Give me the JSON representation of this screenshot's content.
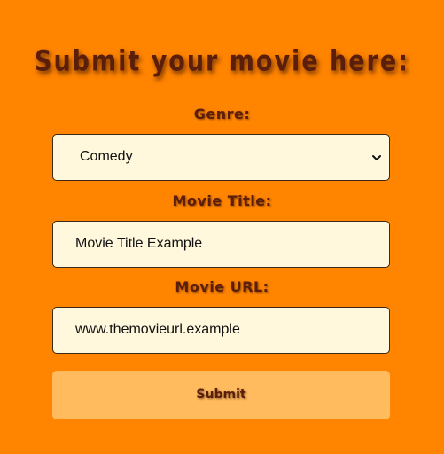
{
  "form": {
    "title": "Submit your movie here:",
    "genre": {
      "label": "Genre:",
      "selected": "Comedy"
    },
    "movie_title": {
      "label": "Movie Title:",
      "value": "Movie Title Example"
    },
    "movie_url": {
      "label": "Movie URL:",
      "value": "www.themovieurl.example"
    },
    "submit_label": "Submit"
  },
  "colors": {
    "background": "#ff8400",
    "field_background": "#fff8dc",
    "heading_text": "#5a1e0a",
    "submit_background": "#ffbb5e"
  },
  "icons": {
    "select_chevron": "chevron-down-icon"
  }
}
